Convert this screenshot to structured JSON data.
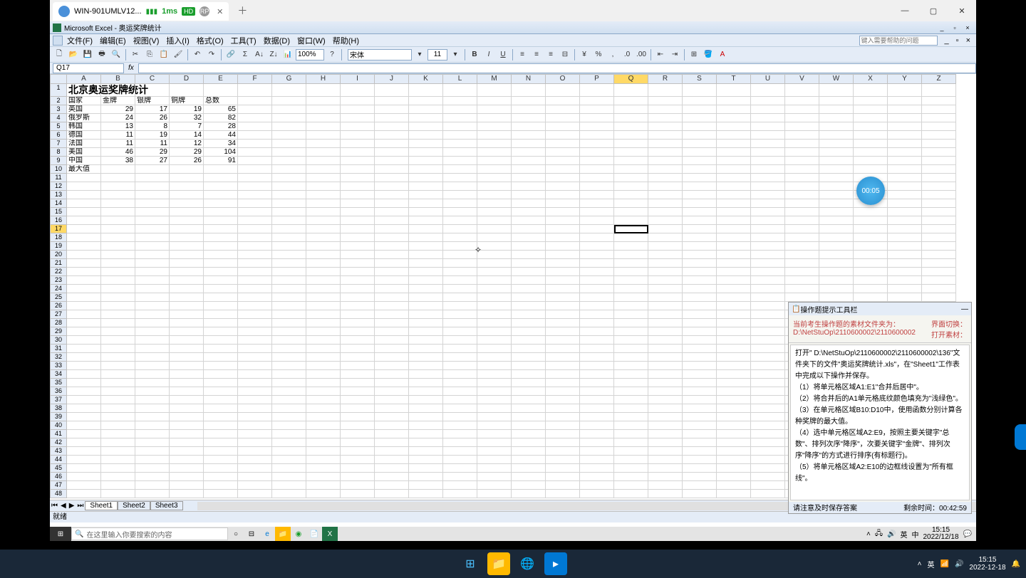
{
  "remote_tab": {
    "title": "WIN-901UMLV12...",
    "latency": "1ms",
    "hd": "HD",
    "rp": "RP"
  },
  "excel": {
    "title": "Microsoft Excel - 奥运奖牌统计",
    "menus": [
      "文件(F)",
      "编辑(E)",
      "视图(V)",
      "插入(I)",
      "格式(O)",
      "工具(T)",
      "数据(D)",
      "窗口(W)",
      "帮助(H)"
    ],
    "help_placeholder": "键入需要帮助的问题",
    "zoom": "100%",
    "font_name": "宋体",
    "font_size": "11",
    "active_cell": "Q17",
    "status": "就绪",
    "sheets": [
      "Sheet1",
      "Sheet2",
      "Sheet3"
    ],
    "columns": [
      "A",
      "B",
      "C",
      "D",
      "E",
      "F",
      "G",
      "H",
      "I",
      "J",
      "K",
      "L",
      "M",
      "N",
      "O",
      "P",
      "Q",
      "R",
      "S",
      "T",
      "U",
      "V",
      "W",
      "X",
      "Y",
      "Z"
    ],
    "title_cell": "北京奥运奖牌统计",
    "headers": [
      "国家",
      "金牌",
      "银牌",
      "铜牌",
      "总数"
    ],
    "rows": [
      [
        "英国",
        "29",
        "17",
        "19",
        "65"
      ],
      [
        "俄罗斯",
        "24",
        "26",
        "32",
        "82"
      ],
      [
        "韩国",
        "13",
        "8",
        "7",
        "28"
      ],
      [
        "德国",
        "11",
        "19",
        "14",
        "44"
      ],
      [
        "法国",
        "11",
        "11",
        "12",
        "34"
      ],
      [
        "美国",
        "46",
        "29",
        "29",
        "104"
      ],
      [
        "中国",
        "38",
        "27",
        "26",
        "91"
      ]
    ],
    "max_label": "最大值"
  },
  "timer": "00:05",
  "panel": {
    "title": "操作题提示工具栏",
    "info1": "当前考生操作题的素材文件夹为：",
    "info2": "D:\\NetStuOp\\2110600002\\2110600002",
    "side1": "界面切换：",
    "side2": "打开素材：",
    "body": "打开\" D:\\NetStuOp\\2110600002\\2110600002\\136\"文件夹下的文件\"奥运奖牌统计.xls\"，在\"Sheet1\"工作表中完成以下操作并保存。\n（1）将单元格区域A1:E1\"合并后居中\"。\n（2）将合并后的A1单元格底纹颜色填充为\"浅绿色\"。\n（3）在单元格区域B10:D10中，使用函数分别计算各种奖牌的最大值。\n（4）选中单元格区域A2:E9，按照主要关键字\"总数\"、排列次序\"降序\"，次要关键字\"金牌\"、排列次序\"降序\"的方式进行排序(有标题行)。\n（5）将单元格区域A2:E10的边框线设置为\"所有框线\"。",
    "footer_left": "请注意及时保存答案",
    "footer_right": "剩余时间：00:42:59"
  },
  "inner_taskbar": {
    "search_placeholder": "在这里输入你要搜索的内容",
    "time": "15:15",
    "date": "2022/12/18",
    "ime": "英",
    "ime2": "中"
  },
  "outer_taskbar": {
    "time": "15:15",
    "date": "2022-12-18",
    "ime": "英"
  },
  "chart_data": {
    "type": "table",
    "title": "北京奥运奖牌统计",
    "columns": [
      "国家",
      "金牌",
      "银牌",
      "铜牌",
      "总数"
    ],
    "rows": [
      {
        "国家": "英国",
        "金牌": 29,
        "银牌": 17,
        "铜牌": 19,
        "总数": 65
      },
      {
        "国家": "俄罗斯",
        "金牌": 24,
        "银牌": 26,
        "铜牌": 32,
        "总数": 82
      },
      {
        "国家": "韩国",
        "金牌": 13,
        "银牌": 8,
        "铜牌": 7,
        "总数": 28
      },
      {
        "国家": "德国",
        "金牌": 11,
        "银牌": 19,
        "铜牌": 14,
        "总数": 44
      },
      {
        "国家": "法国",
        "金牌": 11,
        "银牌": 11,
        "铜牌": 12,
        "总数": 34
      },
      {
        "国家": "美国",
        "金牌": 46,
        "银牌": 29,
        "铜牌": 29,
        "总数": 104
      },
      {
        "国家": "中国",
        "金牌": 38,
        "银牌": 27,
        "铜牌": 26,
        "总数": 91
      }
    ]
  }
}
